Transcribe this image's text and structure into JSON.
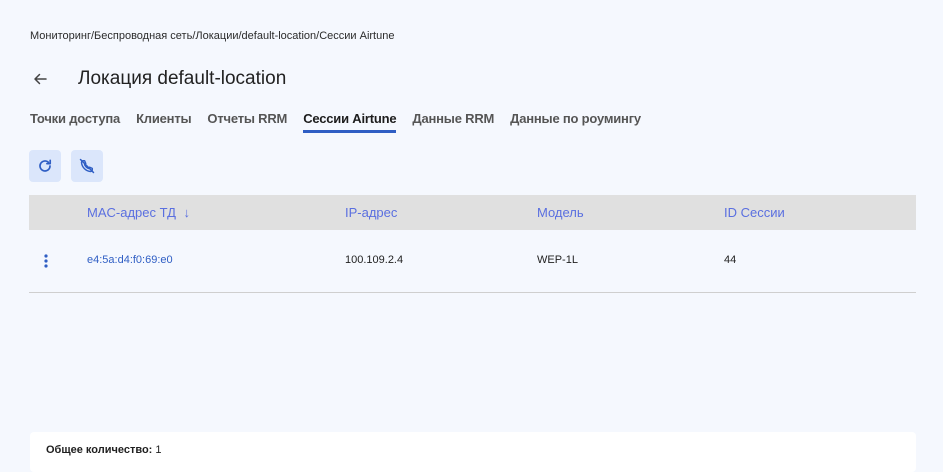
{
  "breadcrumb": "Мониторинг/Беспроводная сеть/Локации/default-location/Сессии Airtune",
  "page": {
    "title": "Локация default-location"
  },
  "tabs": [
    {
      "label": "Точки доступа"
    },
    {
      "label": "Клиенты"
    },
    {
      "label": "Отчеты RRM"
    },
    {
      "label": "Сессии Airtune",
      "active": true
    },
    {
      "label": "Данные RRM"
    },
    {
      "label": "Данные по роумингу"
    }
  ],
  "toolbar": {
    "icons": [
      "refresh-icon",
      "phone-off-icon"
    ]
  },
  "table": {
    "columns": {
      "mac": "MAC-адрес ТД",
      "mac_sort_icon": "↓",
      "ip": "IP-адрес",
      "model": "Модель",
      "session": "ID Сессии"
    },
    "rows": [
      {
        "mac": "e4:5a:d4:f0:69:e0",
        "ip": "100.109.2.4",
        "model": "WEP-1L",
        "session": "44"
      }
    ]
  },
  "footer": {
    "label": "Общее количество:",
    "count": "1"
  },
  "colors": {
    "accent": "#2f5ec4",
    "header_text": "#5a6fe0",
    "button_bg": "#dbe6fb"
  }
}
